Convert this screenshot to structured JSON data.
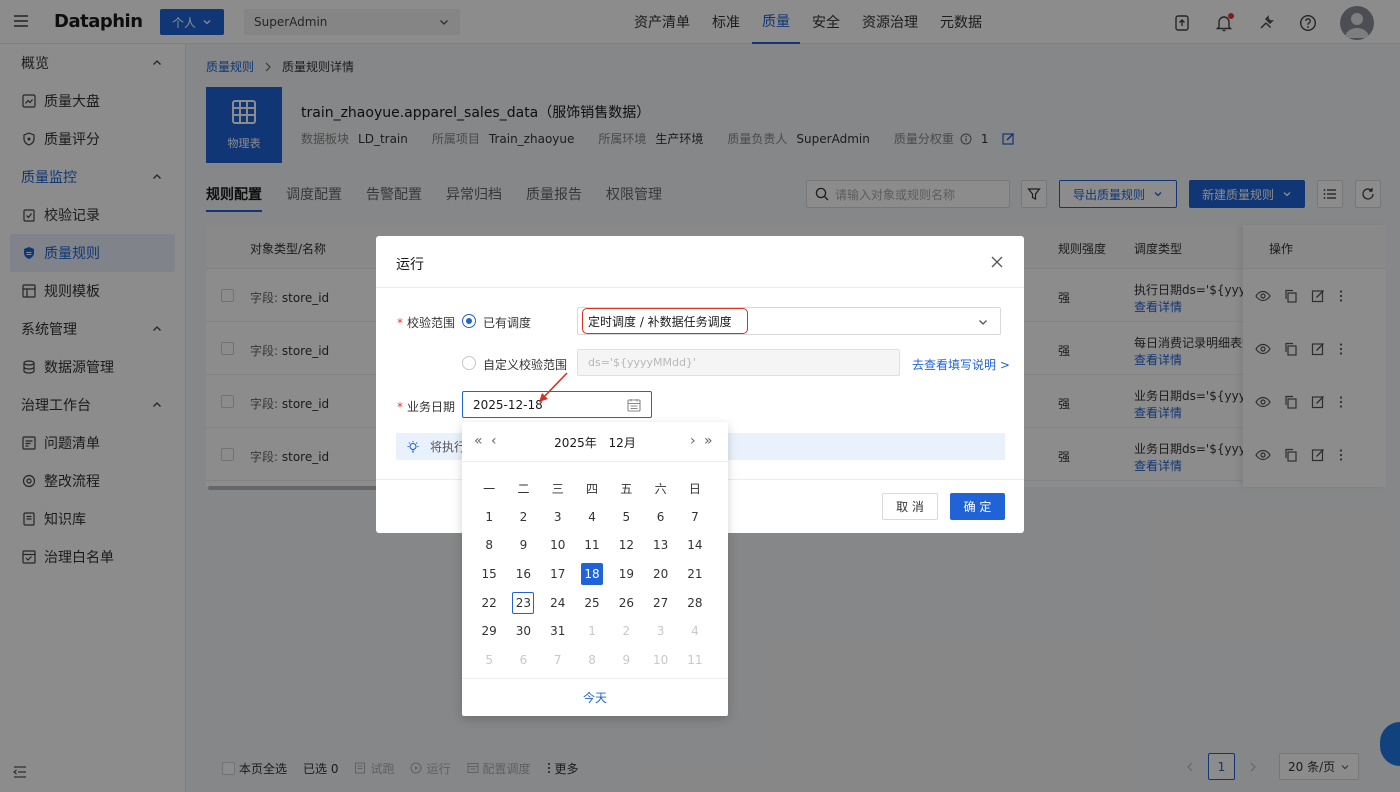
{
  "nav": {
    "logo": "Dataphin",
    "personal_label": "个人",
    "tenant": "SuperAdmin",
    "menu": [
      {
        "label": "资产清单",
        "active": false
      },
      {
        "label": "标准",
        "active": false
      },
      {
        "label": "质量",
        "active": true
      },
      {
        "label": "安全",
        "active": false
      },
      {
        "label": "资源治理",
        "active": false
      },
      {
        "label": "元数据",
        "active": false
      }
    ],
    "icons": [
      "upload-icon",
      "bell-icon",
      "tools-icon",
      "help-icon",
      "user-avatar"
    ]
  },
  "sidebar": {
    "groups": [
      {
        "label": "概览",
        "items": [
          "质量大盘",
          "质量评分"
        ]
      },
      {
        "label": "质量监控",
        "items": [
          "校验记录",
          "质量规则",
          "规则模板"
        ]
      },
      {
        "label": "系统管理",
        "items": [
          "数据源管理"
        ]
      },
      {
        "label": "治理工作台",
        "items": [
          "问题清单",
          "整改流程",
          "知识库",
          "治理白名单"
        ]
      }
    ],
    "active_item": "质量规则"
  },
  "breadcrumb": {
    "parent": "质量规则",
    "current": "质量规则详情"
  },
  "asset": {
    "icon_label": "物理表",
    "title": "train_zhaoyue.apparel_sales_data（服饰销售数据）",
    "meta": [
      {
        "key": "数据板块",
        "value": "LD_train"
      },
      {
        "key": "所属项目",
        "value": "Train_zhaoyue"
      },
      {
        "key": "所属环境",
        "value": "生产环境"
      },
      {
        "key": "质量负责人",
        "value": "SuperAdmin"
      },
      {
        "key": "质量分权重",
        "value": "1"
      }
    ]
  },
  "tabs": [
    "规则配置",
    "调度配置",
    "告警配置",
    "异常归档",
    "质量报告",
    "权限管理"
  ],
  "toolbar": {
    "search_placeholder": "请输入对象或规则名称",
    "export_label": "导出质量规则",
    "new_label": "新建质量规则"
  },
  "table": {
    "headers": {
      "name": "对象类型/名称",
      "strength": "规则强度",
      "schedule": "调度类型",
      "ops": "操作"
    },
    "rows": [
      {
        "type": "字段:",
        "name": "store_id",
        "strength": "强",
        "schedule": "执行日期ds='${yyyyMMdd}'",
        "detail": "查看详情"
      },
      {
        "type": "字段:",
        "name": "store_id",
        "strength": "强",
        "schedule": "每日消费记录明细表数据",
        "detail": "查看详情"
      },
      {
        "type": "字段:",
        "name": "store_id",
        "strength": "强",
        "schedule": "业务日期ds='${yyyyMMdd}'",
        "detail": "查看详情"
      },
      {
        "type": "字段:",
        "name": "store_id",
        "strength": "强",
        "schedule": "业务日期ds='${yyyyMMdd}'",
        "detail": "查看详情"
      }
    ]
  },
  "footer": {
    "select_all": "本页全选",
    "selected": "已选 0",
    "trial": "试跑",
    "run": "运行",
    "config": "配置调度",
    "more": "更多",
    "page": "1",
    "page_size": "20 条/页"
  },
  "modal": {
    "title": "运行",
    "scope_label": "校验范围",
    "option_existing": "已有调度",
    "schedule_value": "定时调度 / 补数据任务调度",
    "option_custom": "自定义校验范围",
    "custom_placeholder": "ds='${yyyyMMdd}'",
    "howto_link": "去查看填写说明 >",
    "date_label": "业务日期",
    "date_value": "2025-12-18",
    "info_text": "将执行",
    "cancel": "取 消",
    "ok": "确 定"
  },
  "datepicker": {
    "year": "2025年",
    "month": "12月",
    "weekdays": [
      "一",
      "二",
      "三",
      "四",
      "五",
      "六",
      "日"
    ],
    "weeks": [
      [
        "1",
        "2",
        "3",
        "4",
        "5",
        "6",
        "7"
      ],
      [
        "8",
        "9",
        "10",
        "11",
        "12",
        "13",
        "14"
      ],
      [
        "15",
        "16",
        "17",
        "18",
        "19",
        "20",
        "21"
      ],
      [
        "22",
        "23",
        "24",
        "25",
        "26",
        "27",
        "28"
      ],
      [
        "29",
        "30",
        "31",
        "1",
        "2",
        "3",
        "4"
      ],
      [
        "5",
        "6",
        "7",
        "8",
        "9",
        "10",
        "11"
      ]
    ],
    "selected": "18",
    "today": "23",
    "today_label": "今天"
  }
}
